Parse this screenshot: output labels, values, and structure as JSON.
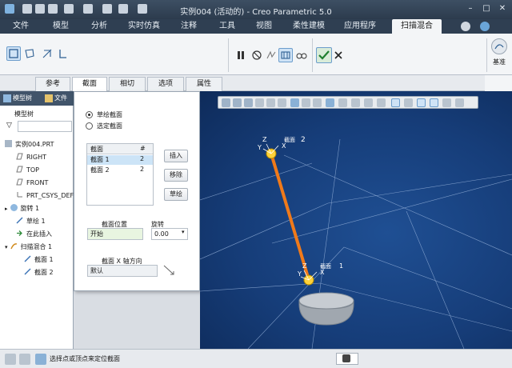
{
  "window": {
    "title": "实例004 (活动的) - Creo Parametric 5.0"
  },
  "ribbon_tabs": [
    {
      "label": "文件"
    },
    {
      "label": "模型"
    },
    {
      "label": "分析"
    },
    {
      "label": "实时仿真"
    },
    {
      "label": "注释"
    },
    {
      "label": "工具"
    },
    {
      "label": "视图"
    },
    {
      "label": "柔性建模"
    },
    {
      "label": "应用程序"
    },
    {
      "label": "扫描混合"
    }
  ],
  "ribbon": {
    "right_label": "基准"
  },
  "sub_tabs": [
    {
      "label": "参考"
    },
    {
      "label": "截面"
    },
    {
      "label": "相切"
    },
    {
      "label": "选项"
    },
    {
      "label": "属性"
    }
  ],
  "left_panel": {
    "tabs": [
      {
        "label": "模型树"
      },
      {
        "label": "文件"
      }
    ],
    "header": "模型树",
    "items": [
      {
        "label": "实例004.PRT"
      },
      {
        "label": "RIGHT"
      },
      {
        "label": "TOP"
      },
      {
        "label": "FRONT"
      },
      {
        "label": "PRT_CSYS_DEF"
      },
      {
        "label": "旋转 1"
      },
      {
        "label": "草绘 1"
      },
      {
        "label": "在此插入"
      },
      {
        "label": "扫描混合 1"
      },
      {
        "label": "截面 1"
      },
      {
        "label": "截面 2"
      }
    ]
  },
  "section_panel": {
    "radio_sketch": "草绘截面",
    "radio_selected": "选定截面",
    "table_headers": {
      "name": "截面",
      "num": "#"
    },
    "rows": [
      {
        "name": "截面 1",
        "num": "2"
      },
      {
        "name": "截面 2",
        "num": "2"
      }
    ],
    "insert_button": "插入",
    "remove_button": "移除",
    "sketch_button": "草绘",
    "position_label": "截面位置",
    "position_value": "开始",
    "rotation_label": "旋转",
    "rotation_value": "0.00",
    "xdir_label": "截面 X 轴方向",
    "xdir_value": "默认"
  },
  "viewport": {
    "top_label": "截面",
    "top_num": "2",
    "bottom_label": "截面",
    "bottom_num": "1",
    "axis_x": "X",
    "axis_y": "Y",
    "axis_z": "Z"
  },
  "status": {
    "message": "选择点或顶点来定位截面"
  },
  "colors": {
    "accent_active": "#cfe3f6",
    "trajectory": "#f07a1a",
    "viewport_bg": "#163d79"
  }
}
